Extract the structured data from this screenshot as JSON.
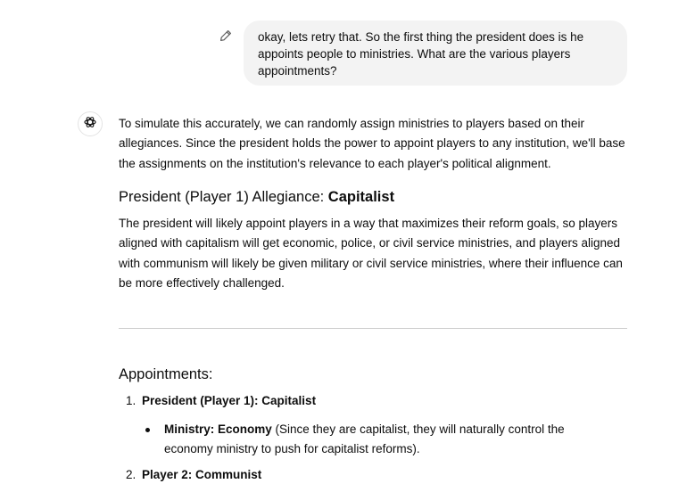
{
  "user_message": {
    "text": "okay, lets retry that. So the first thing the president does is he appoints people to ministries. What are the various players appointments?"
  },
  "assistant": {
    "intro": "To simulate this accurately, we can randomly assign ministries to players based on their allegiances. Since the president holds the power to appoint players to any institution, we'll base the assignments on the institution's relevance to each player's political alignment.",
    "heading_prefix": "President (Player 1) Allegiance: ",
    "heading_bold": "Capitalist",
    "reform_paragraph": "The president will likely appoint players in a way that maximizes their reform goals, so players aligned with capitalism will get economic, police, or civil service ministries, and players aligned with communism will likely be given military or civil service ministries, where their influence can be more effectively challenged.",
    "appointments_heading": "Appointments:",
    "list": [
      {
        "number": "1.",
        "label": "President (Player 1): Capitalist",
        "sub_label": "Ministry: Economy",
        "sub_text": " (Since they are capitalist, they will naturally control the economy ministry to push for capitalist reforms)."
      },
      {
        "number": "2.",
        "label": "Player 2: Communist"
      }
    ]
  },
  "icons": {
    "edit": "pencil-icon",
    "avatar": "assistant-logo-icon"
  },
  "colors": {
    "bubble": "#f3f3f3",
    "text": "#0d0d0d",
    "divider": "#cfcfcf"
  }
}
